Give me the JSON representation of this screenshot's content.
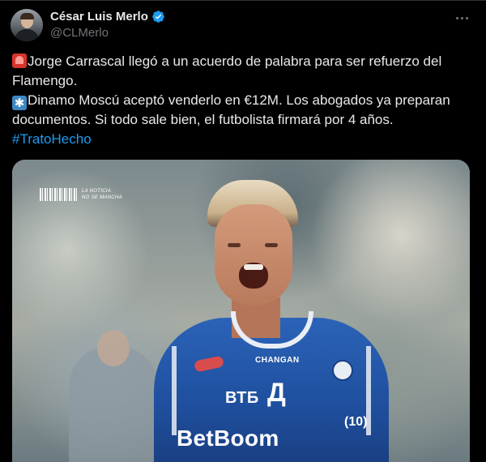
{
  "author": {
    "name": "César Luis Merlo",
    "handle": "@CLMerlo",
    "verified_color": "#1d9bf0"
  },
  "tweet": {
    "line1": "Jorge Carrascal llegó a un acuerdo de palabra para ser refuerzo del",
    "line2": "Flamengo.",
    "line3": "Dinamo Moscú aceptó venderlo en €12M. Los abogados ya preparan",
    "line4": "documentos. Si todo sale bien, el futbolista firmará por 4 años.",
    "hashtag": "#TratoHecho",
    "emoji1": "rotating-light-emoji",
    "emoji2": "asterisk-emoji"
  },
  "media": {
    "tag_line1": "LA NOTICIA",
    "tag_line2": "NO SE MANCHA",
    "jersey_top": "CHANGAN",
    "jersey_bank": "ВТБ",
    "jersey_club": "Д",
    "jersey_sponsor": "BetBoom",
    "jersey_number": "(10)"
  },
  "colors": {
    "background": "#000000",
    "text": "#e7e9ea",
    "muted": "#71767b",
    "link": "#1d9bf0"
  }
}
